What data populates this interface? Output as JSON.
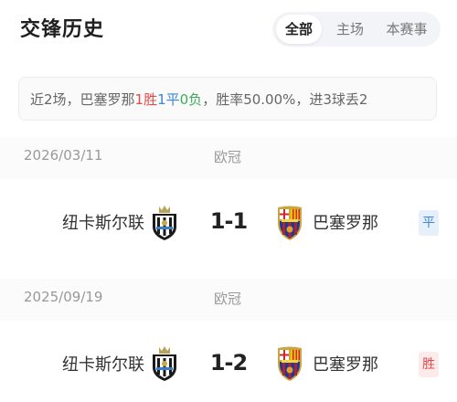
{
  "header": {
    "title": "交锋历史",
    "tabs": [
      {
        "label": "全部",
        "active": true
      },
      {
        "label": "主场",
        "active": false
      },
      {
        "label": "本赛事",
        "active": false
      }
    ]
  },
  "summary": {
    "prefix": "近2场，巴塞罗那",
    "wins": "1胜",
    "draws": "1平",
    "losses": "0负",
    "suffix": "，胜率50.00%，进3球丢2"
  },
  "matches": [
    {
      "date": "2026/03/11",
      "league": "欧冠",
      "home": "纽卡斯尔联",
      "score": "1-1",
      "away": "巴塞罗那",
      "result": "平"
    },
    {
      "date": "2025/09/19",
      "league": "欧冠",
      "home": "纽卡斯尔联",
      "score": "1-2",
      "away": "巴塞罗那",
      "result": "胜"
    }
  ],
  "colors": {
    "win": "#e24a4a",
    "draw": "#3a86d8",
    "loss": "#3bab5b"
  },
  "icons": {
    "home_logo": "newcastle-crest-icon",
    "away_logo": "barcelona-crest-icon"
  }
}
